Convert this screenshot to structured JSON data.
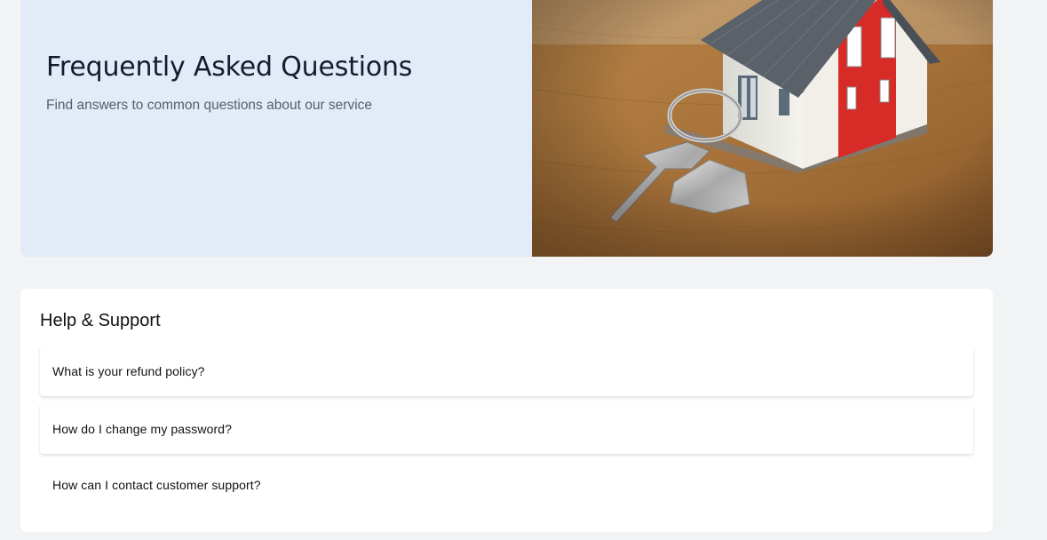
{
  "hero": {
    "title": "Frequently Asked Questions",
    "subtitle": "Find answers to common questions about our service",
    "image_subject": "model-house-with-keys"
  },
  "support": {
    "title": "Help & Support",
    "faqs": [
      {
        "question": "What is your refund policy?"
      },
      {
        "question": "How do I change my password?"
      },
      {
        "question": "How can I contact customer support?"
      }
    ]
  },
  "colors": {
    "page_bg": "#f2f3f5",
    "hero_bg": "#e3eaf8",
    "title_text": "#141c2e",
    "subtitle_text": "#585f6b",
    "card_bg": "#ffffff"
  }
}
